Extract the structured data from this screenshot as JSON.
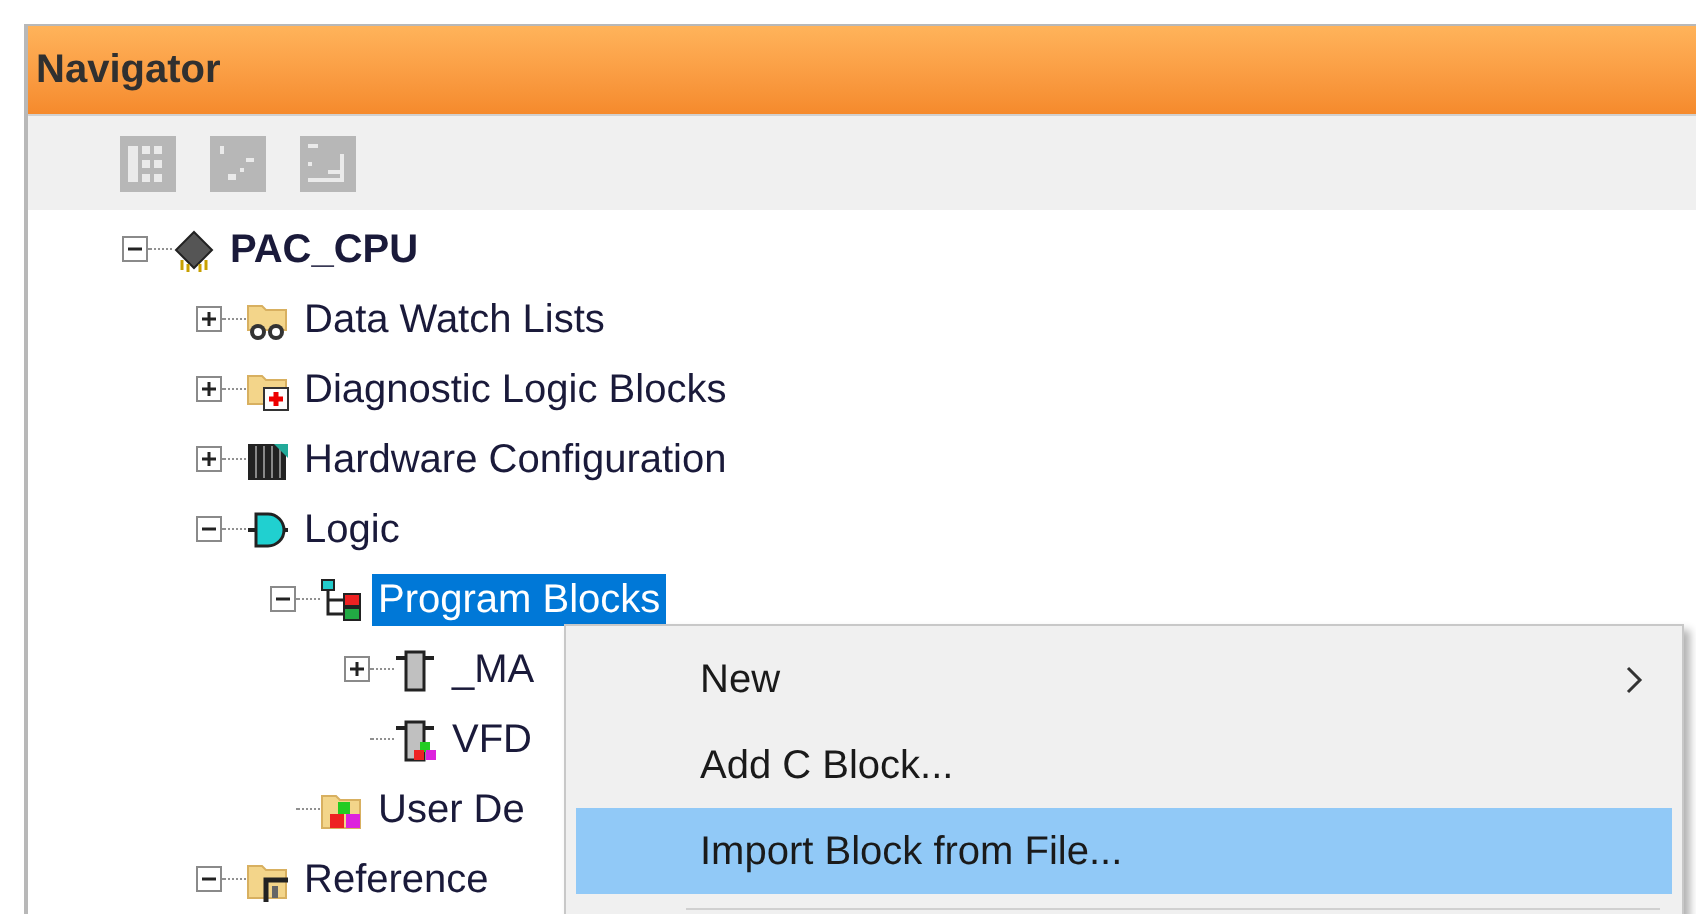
{
  "window": {
    "title": "Navigator"
  },
  "toolbar": {
    "buttons": [
      {
        "kind": "grid",
        "disabled": true
      },
      {
        "kind": "scatter",
        "disabled": true
      },
      {
        "kind": "steps",
        "disabled": true
      }
    ]
  },
  "tree": [
    {
      "label": "PAC_CPU",
      "kind": "cpu",
      "bold": true,
      "expanded": true,
      "selected": false,
      "children": [
        {
          "label": "Data Watch Lists",
          "kind": "watch-folder",
          "expanded": false,
          "selected": false
        },
        {
          "label": "Diagnostic Logic Blocks",
          "kind": "diagnostic-folder",
          "expanded": false,
          "selected": false
        },
        {
          "label": "Hardware Configuration",
          "kind": "hardware",
          "expanded": false,
          "selected": false
        },
        {
          "label": "Logic",
          "kind": "logic",
          "expanded": true,
          "selected": false,
          "children": [
            {
              "label": "Program Blocks",
              "kind": "program-blocks",
              "expanded": true,
              "selected": true,
              "children": [
                {
                  "label": "_MA",
                  "kind": "block",
                  "expanded": false,
                  "selected": false
                },
                {
                  "label": "VFD",
                  "kind": "block-udt",
                  "selected": false
                }
              ]
            },
            {
              "label": "User De",
              "kind": "udt-folder",
              "selected": false
            }
          ]
        },
        {
          "label": "Reference",
          "kind": "reference-folder",
          "expanded": true,
          "selected": false
        }
      ]
    }
  ],
  "context_menu": {
    "items": [
      {
        "label": "New",
        "submenu": true,
        "selected": false
      },
      {
        "label": "Add C Block...",
        "submenu": false,
        "selected": false
      },
      {
        "label": "Import Block from File...",
        "submenu": false,
        "selected": true
      }
    ]
  }
}
